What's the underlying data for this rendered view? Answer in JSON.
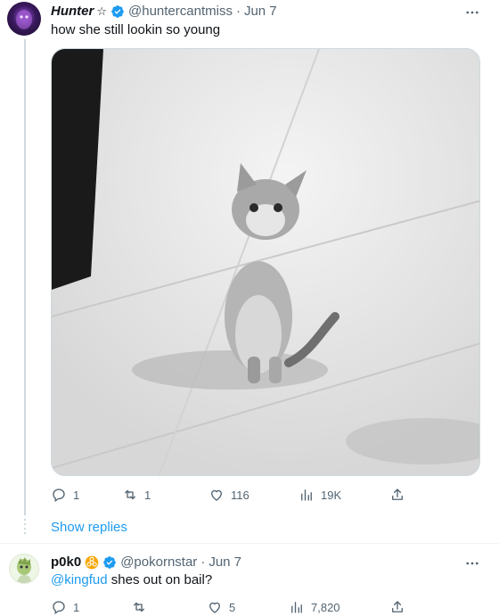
{
  "tweet": {
    "author": {
      "display_name": "Hunter",
      "name_suffix": "☆",
      "handle": "@huntercantmiss",
      "verified": true,
      "avatar_icon": "dark-purple-avatar"
    },
    "separator": "·",
    "date": "Jun 7",
    "text": "how she still lookin so young",
    "media_icon": "kitten-photo",
    "actions": {
      "replies": "1",
      "retweets": "1",
      "likes": "116",
      "views": "19K"
    }
  },
  "show_replies_label": "Show replies",
  "reply": {
    "author": {
      "display_name": "p0k0",
      "handle": "@pokornstar",
      "verified": true,
      "avatar_icon": "cartoon-avatar"
    },
    "separator": "·",
    "date": "Jun 7",
    "mention": "@kingfud",
    "text": " shes out on bail?",
    "actions": {
      "replies": "1",
      "retweets": "",
      "likes": "5",
      "views": "7,820"
    }
  },
  "colors": {
    "accent": "#1d9bf0",
    "text_primary": "#0f1419",
    "text_secondary": "#536471",
    "badge_orange": "#f7a600"
  }
}
